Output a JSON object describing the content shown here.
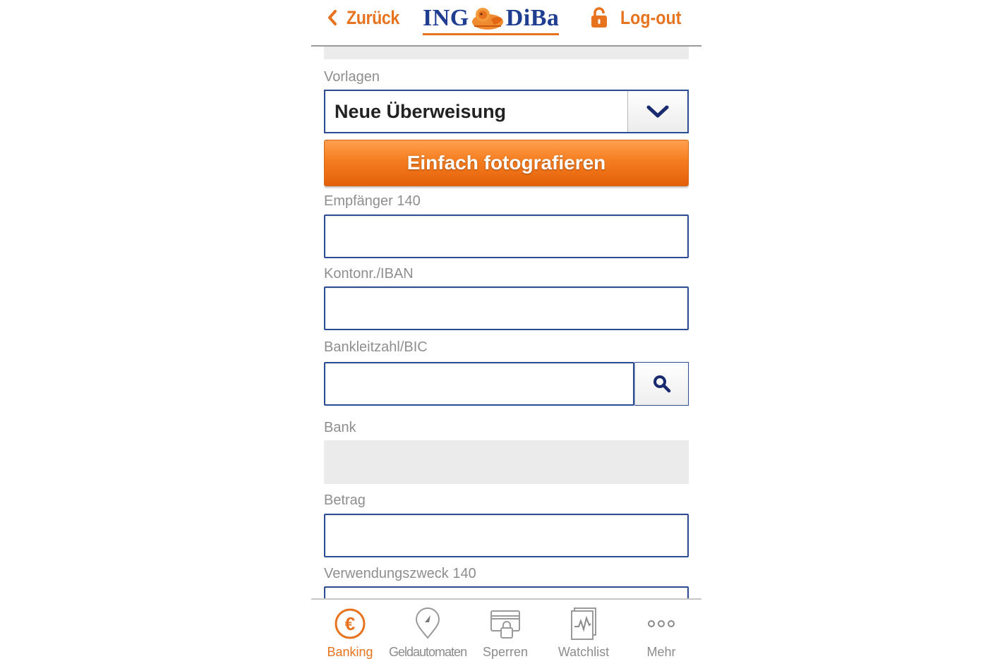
{
  "header": {
    "back_label": "Zurück",
    "logo_left": "ING",
    "logo_right": "DiBa",
    "logout_label": "Log-out"
  },
  "form": {
    "templates_label": "Vorlagen",
    "templates_value": "Neue Überweisung",
    "photo_button_label": "Einfach fotografieren",
    "recipient_label": "Empfänger 140",
    "recipient_value": "",
    "account_label": "Kontonr./IBAN",
    "account_value": "",
    "bic_label": "Bankleitzahl/BIC",
    "bic_value": "",
    "bank_label": "Bank",
    "amount_label": "Betrag",
    "amount_value": "",
    "purpose_label": "Verwendungszweck 140"
  },
  "tabbar": {
    "items": [
      {
        "label": "Banking",
        "icon": "euro-icon",
        "active": true
      },
      {
        "label": "Geldautomaten",
        "icon": "location-pin-icon",
        "active": false
      },
      {
        "label": "Sperren",
        "icon": "card-lock-icon",
        "active": false
      },
      {
        "label": "Watchlist",
        "icon": "chart-document-icon",
        "active": false
      },
      {
        "label": "Mehr",
        "icon": "more-dots-icon",
        "active": false
      }
    ]
  },
  "colors": {
    "accent_orange": "#e8731e",
    "brand_blue": "#1f3e91",
    "field_border": "#2b4b92",
    "label_gray": "#8e8e8e",
    "readonly_gray": "#ebebeb"
  }
}
